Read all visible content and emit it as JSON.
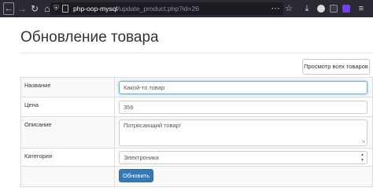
{
  "browser": {
    "url_host": "php-oop-mysql",
    "url_path": "/update_product.php?id=26",
    "icons": {
      "back": "back-arrow-icon",
      "forward": "forward-arrow-icon",
      "reload": "reload-icon",
      "home": "home-icon",
      "tracking": "shield-icon",
      "page": "page-icon",
      "actions": "more-dots-icon",
      "bookmark": "star-icon",
      "downloads": "download-icon",
      "menu": "hamburger-icon"
    },
    "colors": {
      "toolbar_bg": "#2b2a33",
      "urlbar_bg": "#1c1b22",
      "ext_a": "#dddddd",
      "ext_b": "#3a3a44",
      "ext_c": "#7542e5"
    }
  },
  "page": {
    "title": "Обновление товара",
    "view_all_button": "Просмотр всех товаров"
  },
  "form": {
    "rows": [
      {
        "label": "Название",
        "value": "Какой-то товар"
      },
      {
        "label": "Цена",
        "value": "356"
      },
      {
        "label": "Описание",
        "value": "Потрясающий товар!"
      },
      {
        "label": "Категория",
        "value": "Электроника"
      }
    ],
    "submit_label": "Обновить",
    "colors": {
      "primary": "#337ab7",
      "focus_border": "#66afe9",
      "row_stripe": "#f9f9f9"
    }
  }
}
